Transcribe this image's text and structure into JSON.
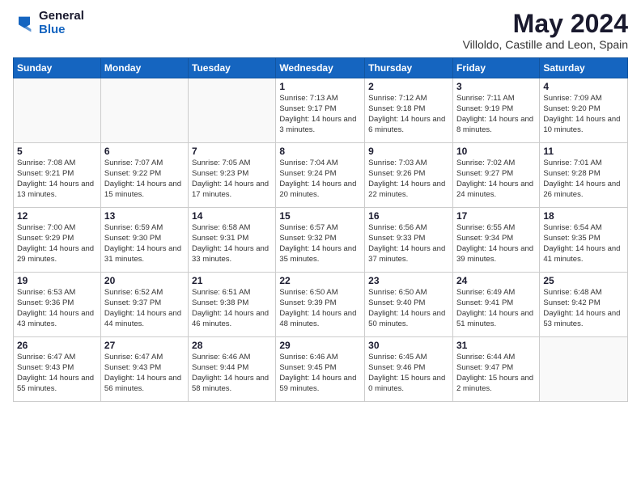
{
  "logo": {
    "general": "General",
    "blue": "Blue"
  },
  "title": {
    "month": "May 2024",
    "location": "Villoldo, Castille and Leon, Spain"
  },
  "days_of_week": [
    "Sunday",
    "Monday",
    "Tuesday",
    "Wednesday",
    "Thursday",
    "Friday",
    "Saturday"
  ],
  "weeks": [
    [
      {
        "day": "",
        "info": ""
      },
      {
        "day": "",
        "info": ""
      },
      {
        "day": "",
        "info": ""
      },
      {
        "day": "1",
        "info": "Sunrise: 7:13 AM\nSunset: 9:17 PM\nDaylight: 14 hours and 3 minutes."
      },
      {
        "day": "2",
        "info": "Sunrise: 7:12 AM\nSunset: 9:18 PM\nDaylight: 14 hours and 6 minutes."
      },
      {
        "day": "3",
        "info": "Sunrise: 7:11 AM\nSunset: 9:19 PM\nDaylight: 14 hours and 8 minutes."
      },
      {
        "day": "4",
        "info": "Sunrise: 7:09 AM\nSunset: 9:20 PM\nDaylight: 14 hours and 10 minutes."
      }
    ],
    [
      {
        "day": "5",
        "info": "Sunrise: 7:08 AM\nSunset: 9:21 PM\nDaylight: 14 hours and 13 minutes."
      },
      {
        "day": "6",
        "info": "Sunrise: 7:07 AM\nSunset: 9:22 PM\nDaylight: 14 hours and 15 minutes."
      },
      {
        "day": "7",
        "info": "Sunrise: 7:05 AM\nSunset: 9:23 PM\nDaylight: 14 hours and 17 minutes."
      },
      {
        "day": "8",
        "info": "Sunrise: 7:04 AM\nSunset: 9:24 PM\nDaylight: 14 hours and 20 minutes."
      },
      {
        "day": "9",
        "info": "Sunrise: 7:03 AM\nSunset: 9:26 PM\nDaylight: 14 hours and 22 minutes."
      },
      {
        "day": "10",
        "info": "Sunrise: 7:02 AM\nSunset: 9:27 PM\nDaylight: 14 hours and 24 minutes."
      },
      {
        "day": "11",
        "info": "Sunrise: 7:01 AM\nSunset: 9:28 PM\nDaylight: 14 hours and 26 minutes."
      }
    ],
    [
      {
        "day": "12",
        "info": "Sunrise: 7:00 AM\nSunset: 9:29 PM\nDaylight: 14 hours and 29 minutes."
      },
      {
        "day": "13",
        "info": "Sunrise: 6:59 AM\nSunset: 9:30 PM\nDaylight: 14 hours and 31 minutes."
      },
      {
        "day": "14",
        "info": "Sunrise: 6:58 AM\nSunset: 9:31 PM\nDaylight: 14 hours and 33 minutes."
      },
      {
        "day": "15",
        "info": "Sunrise: 6:57 AM\nSunset: 9:32 PM\nDaylight: 14 hours and 35 minutes."
      },
      {
        "day": "16",
        "info": "Sunrise: 6:56 AM\nSunset: 9:33 PM\nDaylight: 14 hours and 37 minutes."
      },
      {
        "day": "17",
        "info": "Sunrise: 6:55 AM\nSunset: 9:34 PM\nDaylight: 14 hours and 39 minutes."
      },
      {
        "day": "18",
        "info": "Sunrise: 6:54 AM\nSunset: 9:35 PM\nDaylight: 14 hours and 41 minutes."
      }
    ],
    [
      {
        "day": "19",
        "info": "Sunrise: 6:53 AM\nSunset: 9:36 PM\nDaylight: 14 hours and 43 minutes."
      },
      {
        "day": "20",
        "info": "Sunrise: 6:52 AM\nSunset: 9:37 PM\nDaylight: 14 hours and 44 minutes."
      },
      {
        "day": "21",
        "info": "Sunrise: 6:51 AM\nSunset: 9:38 PM\nDaylight: 14 hours and 46 minutes."
      },
      {
        "day": "22",
        "info": "Sunrise: 6:50 AM\nSunset: 9:39 PM\nDaylight: 14 hours and 48 minutes."
      },
      {
        "day": "23",
        "info": "Sunrise: 6:50 AM\nSunset: 9:40 PM\nDaylight: 14 hours and 50 minutes."
      },
      {
        "day": "24",
        "info": "Sunrise: 6:49 AM\nSunset: 9:41 PM\nDaylight: 14 hours and 51 minutes."
      },
      {
        "day": "25",
        "info": "Sunrise: 6:48 AM\nSunset: 9:42 PM\nDaylight: 14 hours and 53 minutes."
      }
    ],
    [
      {
        "day": "26",
        "info": "Sunrise: 6:47 AM\nSunset: 9:43 PM\nDaylight: 14 hours and 55 minutes."
      },
      {
        "day": "27",
        "info": "Sunrise: 6:47 AM\nSunset: 9:43 PM\nDaylight: 14 hours and 56 minutes."
      },
      {
        "day": "28",
        "info": "Sunrise: 6:46 AM\nSunset: 9:44 PM\nDaylight: 14 hours and 58 minutes."
      },
      {
        "day": "29",
        "info": "Sunrise: 6:46 AM\nSunset: 9:45 PM\nDaylight: 14 hours and 59 minutes."
      },
      {
        "day": "30",
        "info": "Sunrise: 6:45 AM\nSunset: 9:46 PM\nDaylight: 15 hours and 0 minutes."
      },
      {
        "day": "31",
        "info": "Sunrise: 6:44 AM\nSunset: 9:47 PM\nDaylight: 15 hours and 2 minutes."
      },
      {
        "day": "",
        "info": ""
      }
    ]
  ]
}
